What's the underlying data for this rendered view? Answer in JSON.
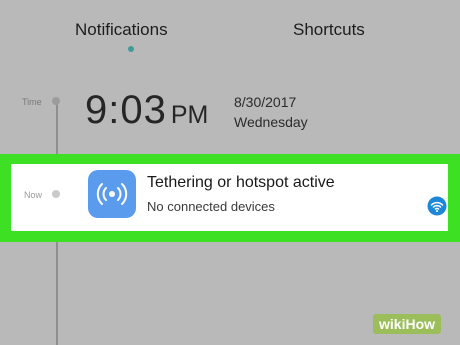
{
  "tabs": {
    "notifications": "Notifications",
    "shortcuts": "Shortcuts"
  },
  "timeline": {
    "time_label": "Time",
    "now_label": "Now"
  },
  "clock": {
    "time": "9:03",
    "ampm": "PM",
    "date": "8/30/2017",
    "weekday": "Wednesday"
  },
  "notification": {
    "title": "Tethering or hotspot active",
    "subtitle": "No connected devices",
    "icon": "hotspot-icon",
    "badge_icon": "wifi-icon",
    "icon_color": "#5a9bee"
  },
  "highlight_color": "#3ee024",
  "watermark": "wikiHow"
}
